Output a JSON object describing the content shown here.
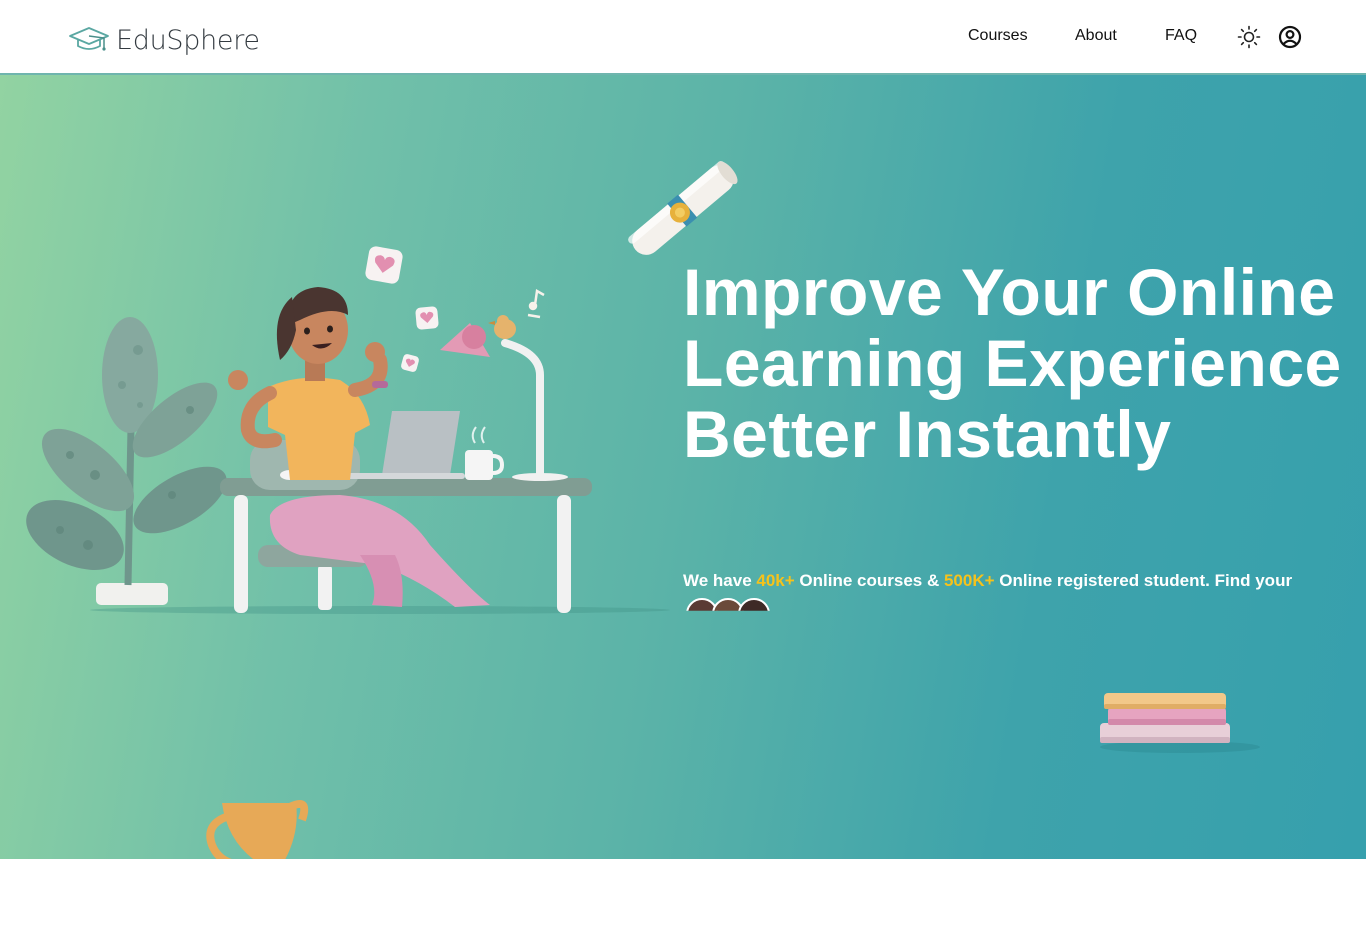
{
  "brand": {
    "name": "EduSphere",
    "logo_icon": "graduation-cap-icon"
  },
  "nav": {
    "links": [
      {
        "label": "Courses"
      },
      {
        "label": "About"
      },
      {
        "label": "FAQ"
      }
    ],
    "theme_icon": "sun-icon",
    "user_icon": "user-circle-icon"
  },
  "hero": {
    "title": "Improve Your Online Learning Experience Better Instantly",
    "subtitle": {
      "part1": "We have ",
      "courses_count": "40k+",
      "part2": " Online courses & ",
      "students_count": "500K+",
      "part3": " Online registered student. Find your desired Courses from them."
    },
    "accent_color": "#f5c21b",
    "gradient": [
      "#92d3a2",
      "#36a0ad"
    ]
  },
  "illustration": {
    "items": [
      "student-at-laptop",
      "potted-plant",
      "desk-lamp",
      "diploma-scroll",
      "book-stack",
      "trophy"
    ]
  }
}
